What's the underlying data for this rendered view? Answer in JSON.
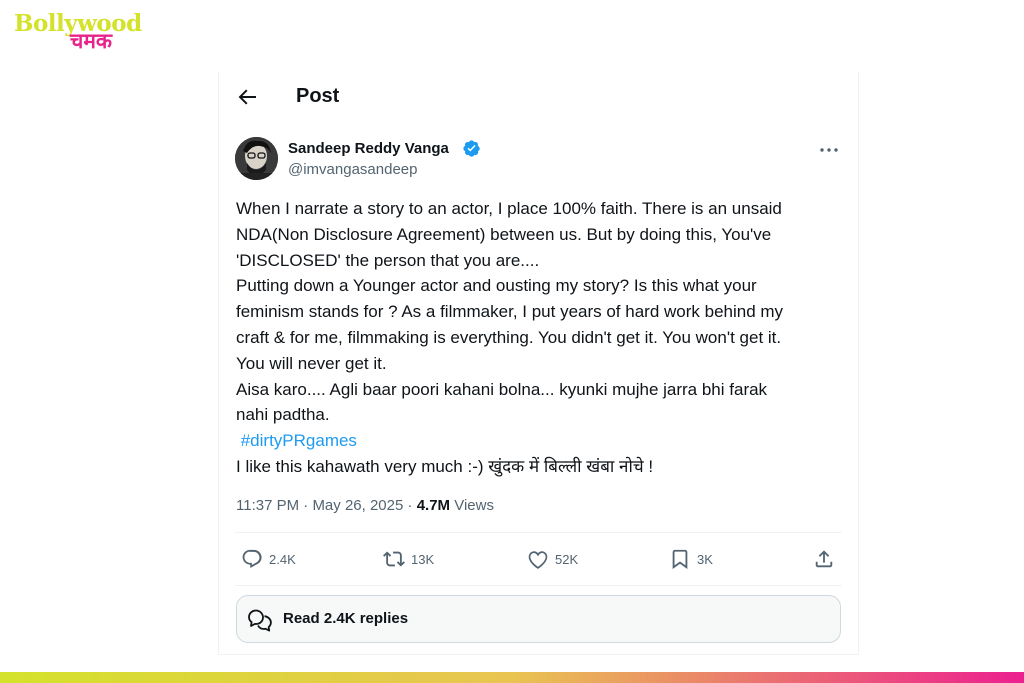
{
  "logo": {
    "top": "Bollywood",
    "bottom": "चमक"
  },
  "header": {
    "title": "Post"
  },
  "author": {
    "name": "Sandeep Reddy Vanga",
    "handle": "@imvangasandeep"
  },
  "tweet": {
    "lines": [
      "When I narrate a story to an actor, I place 100% faith. There is an unsaid",
      "NDA(Non Disclosure Agreement) between us. But by doing this, You've",
      "'DISCLOSED' the person that you are....",
      "Putting down a Younger actor and ousting my story?  Is this what your",
      "feminism stands for ? As a filmmaker, I put years of hard work behind my",
      "craft & for me, filmmaking is everything. You didn't get it. You won't get it.",
      "You will never get it.",
      "Aisa karo.... Agli baar poori kahani bolna... kyunki mujhe jarra bhi farak",
      "nahi padtha."
    ],
    "hashtag": " #dirtyPRgames",
    "last_line": "I like this kahawath very much :-) खुंदक में बिल्ली खंबा नोचे !"
  },
  "meta": {
    "time": "11:37 PM",
    "sep1": " · ",
    "date": "May 26, 2025",
    "sep2": " · ",
    "views_count": "4.7M",
    "views_label": " Views"
  },
  "actions": {
    "replies": "2.4K",
    "reposts": "13K",
    "likes": "52K",
    "bookmarks": "3K"
  },
  "read_replies": "Read 2.4K replies",
  "colors": {
    "accent": "#1d9bf0",
    "logo_yellow": "#d4e22b",
    "logo_pink": "#e8248b"
  },
  "icons": [
    "back-arrow-icon",
    "verified-badge-icon",
    "more-icon",
    "reply-icon",
    "repost-icon",
    "like-icon",
    "bookmark-icon",
    "share-icon",
    "replies-bubble-icon"
  ]
}
